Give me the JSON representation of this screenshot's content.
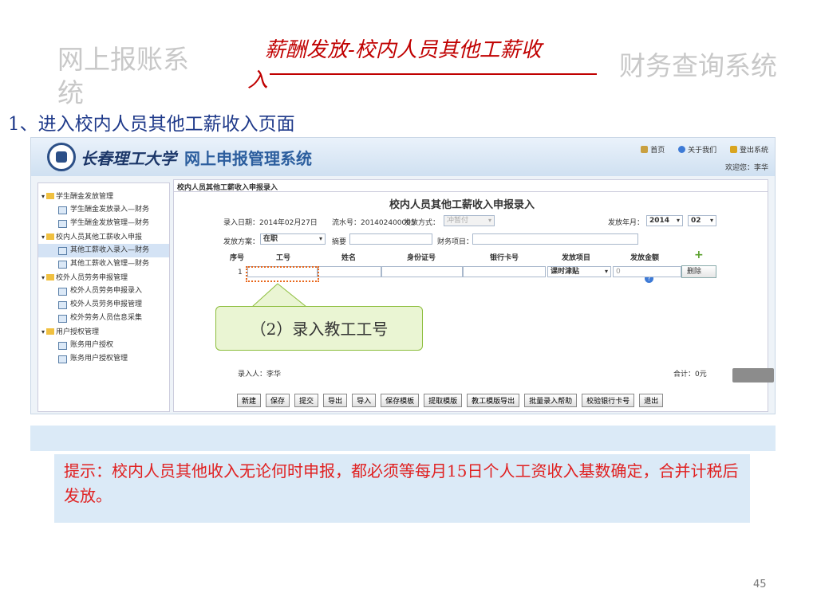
{
  "header": {
    "left_title": "网上报账系统",
    "center_title_line1": "薪酬发放-校内人员其他工薪收",
    "center_title_line2": "入",
    "right_title": "财务查询系统"
  },
  "step_text": "1、进入校内人员其他工薪收入页面",
  "app": {
    "school_name": "长春理工大学",
    "system_title": "网上申报管理系统",
    "top_links": [
      "首页",
      "关于我们",
      "登出系统"
    ],
    "welcome": "欢迎您：李华",
    "sidebar": [
      {
        "type": "group",
        "label": "学生酬金发放管理"
      },
      {
        "type": "item",
        "label": "学生酬金发放录入—财务"
      },
      {
        "type": "item",
        "label": "学生酬金发放管理—财务"
      },
      {
        "type": "group",
        "label": "校内人员其他工薪收入申报"
      },
      {
        "type": "item",
        "label": "其他工薪收入录入—财务",
        "selected": true
      },
      {
        "type": "item",
        "label": "其他工薪收入管理—财务"
      },
      {
        "type": "group",
        "label": "校外人员劳务申报管理"
      },
      {
        "type": "item",
        "label": "校外人员劳务申报录入"
      },
      {
        "type": "item",
        "label": "校外人员劳务申报管理"
      },
      {
        "type": "item",
        "label": "校外劳务人员信息采集"
      },
      {
        "type": "group",
        "label": "用户授权管理"
      },
      {
        "type": "item",
        "label": "账务用户授权"
      },
      {
        "type": "item",
        "label": "账务用户授权管理"
      }
    ],
    "panel_title": "校内人员其他工薪收入申报录入",
    "form_title": "校内人员其他工薪收入申报录入",
    "entry_date": "录入日期：2014年02月27日",
    "serial_no": "流水号：201402400005",
    "pay_method_label": "发放方式：",
    "pay_method_value": "冲暂付",
    "pay_month_label": "发放年月：",
    "pay_year": "2014",
    "pay_month": "02",
    "scheme_label": "发放方案：",
    "scheme_value": "在职",
    "summary_label": "摘要",
    "finance_item_label": "财务项目：",
    "columns": [
      "序号",
      "工号",
      "姓名",
      "身份证号",
      "银行卡号",
      "发放项目",
      "发放金额"
    ],
    "row": {
      "index": "1",
      "pay_item": "课时津贴",
      "amount": "0"
    },
    "delete_label": "删除",
    "entered_by": "录入人：李华",
    "total": "合计：0元",
    "buttons": [
      "新建",
      "保存",
      "提交",
      "导出",
      "导入",
      "保存模板",
      "提取模版",
      "教工模版导出",
      "批量录入帮助",
      "校验银行卡号",
      "退出"
    ]
  },
  "callout": "（2）录入教工工号",
  "tip": "提示：校内人员其他收入无论何时申报，都必须等每月15日个人工资收入基数确定，合并计税后发放。",
  "page_number": "45"
}
